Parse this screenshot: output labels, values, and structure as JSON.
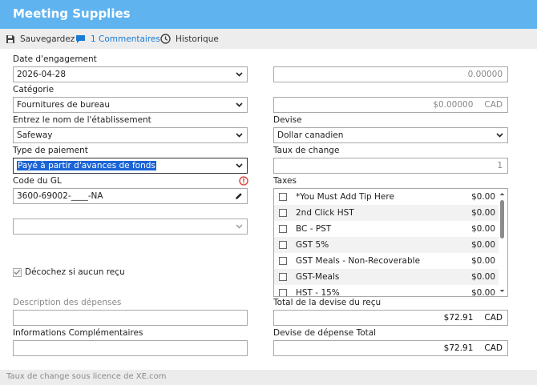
{
  "header": {
    "title": "Meeting Supplies"
  },
  "toolbar": {
    "save": "Sauvegardez",
    "comments": "1 Commentaires",
    "history": "Historique"
  },
  "form": {
    "date": {
      "label": "Date d'engagement",
      "value": "2026-04-28"
    },
    "category": {
      "label": "Catégorie",
      "value": "Fournitures de bureau"
    },
    "merchant": {
      "label": "Entrez le nom de l'établissement",
      "value": "Safeway"
    },
    "payment": {
      "label": "Type de paiement",
      "value": "Payé à partir d'avances de fonds"
    },
    "gl": {
      "label": "Code du GL",
      "value": "3600-69002-____-NA"
    },
    "extra_select": {
      "value": ""
    },
    "no_receipt": {
      "label": "Décochez si aucun reçu",
      "checked": true
    },
    "description": {
      "label": "Description des dépenses",
      "value": ""
    },
    "info": {
      "label": "Informations Complémentaires",
      "value": ""
    }
  },
  "right": {
    "amount": "0.00000",
    "converted": {
      "value": "$0.00000",
      "currency": "CAD"
    },
    "currency": {
      "label": "Devise",
      "value": "Dollar canadien"
    },
    "rate": {
      "label": "Taux de change",
      "value": "1"
    },
    "taxes": {
      "label": "Taxes",
      "items": [
        {
          "name": "*You Must Add Tip Here",
          "amount": "$0.00"
        },
        {
          "name": "2nd Click HST",
          "amount": "$0.00"
        },
        {
          "name": "BC - PST",
          "amount": "$0.00"
        },
        {
          "name": "GST 5%",
          "amount": "$0.00"
        },
        {
          "name": "GST Meals - Non-Recoverable",
          "amount": "$0.00"
        },
        {
          "name": "GST-Meals",
          "amount": "$0.00"
        },
        {
          "name": "HST - 15%",
          "amount": "$0.00"
        }
      ]
    },
    "receipt_total": {
      "label": "Total de la devise du reçu",
      "value": "$72.91",
      "currency": "CAD"
    },
    "expense_total": {
      "label": "Devise de dépense Total",
      "value": "$72.91",
      "currency": "CAD"
    }
  },
  "footer": {
    "text": "Taux de change sous licence de XE.com"
  },
  "colors": {
    "header": "#5fb3ef",
    "accent": "#1a7bd4",
    "error": "#d9342b",
    "selection": "#1a64d6"
  }
}
